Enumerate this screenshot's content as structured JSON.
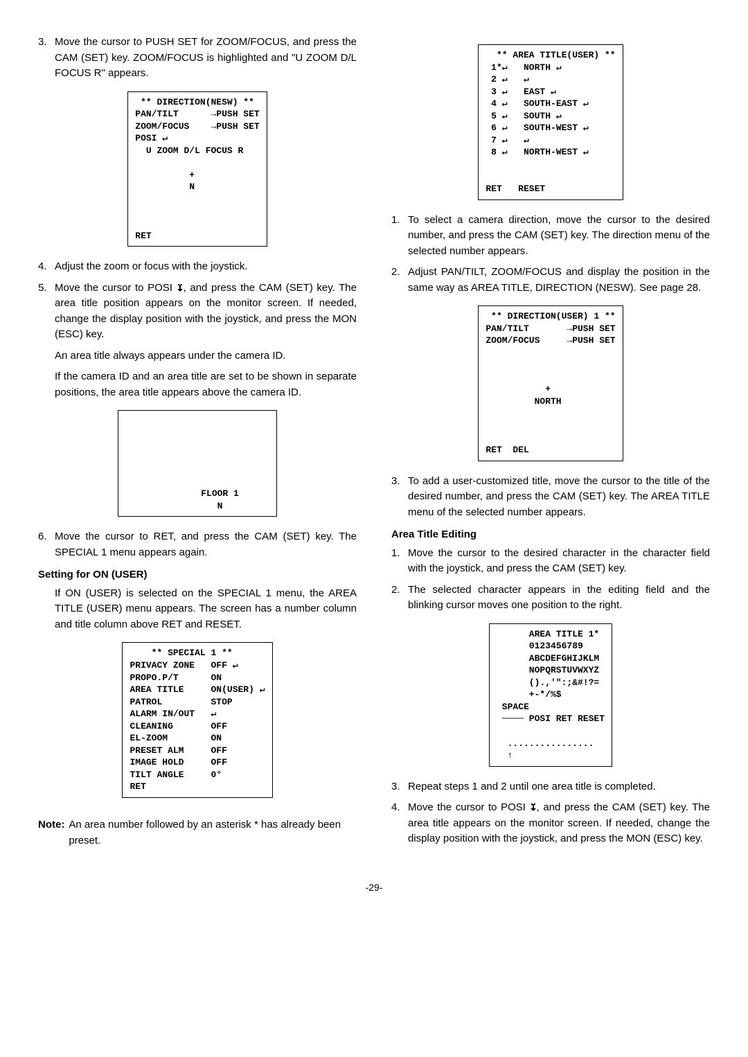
{
  "left": {
    "step3": "Move the cursor to PUSH SET for ZOOM/FOCUS, and press the CAM (SET) key. ZOOM/FOCUS is highlighted and \"U ZOOM D/L FOCUS R\" appears.",
    "menu_direction_nesw": " ** DIRECTION(NESW) **\nPAN/TILT      →PUSH SET\nZOOM/FOCUS    →PUSH SET\nPOSI ↵\n  U ZOOM D/L FOCUS R\n\n          +\n          N\n\n\n\nRET",
    "step4": "Adjust the zoom or focus with the joystick.",
    "step5a": "Move the cursor to POSI ",
    "step5b": ", and press the CAM (SET) key. The area title position appears on the monitor screen. If needed, change the display position with the joystick, and press the MON (ESC) key.",
    "step5_note1": "An area title always appears under the camera ID.",
    "step5_note2": "If the camera ID and an area title are set to be shown in separate positions, the area title appears above the camera ID.",
    "menu_floor": "\n\n\n\n\n\n              FLOOR 1\n                 N   ",
    "step6": "Move the cursor to RET, and press the CAM (SET) key. The SPECIAL 1 menu appears again.",
    "heading_onuser": "Setting for ON (USER)",
    "onuser_body": "If ON (USER) is selected on the SPECIAL 1 menu, the AREA TITLE (USER) menu appears. The screen has a number column and title column above RET and RESET.",
    "menu_special1": "    ** SPECIAL 1 **\nPRIVACY ZONE   OFF ↵\nPROPO.P/T      ON\nAREA TITLE     ON(USER) ↵\nPATROL         STOP\nALARM IN/OUT   ↵\nCLEANING       OFF\nEL-ZOOM        ON\nPRESET ALM     OFF\nIMAGE HOLD     OFF\nTILT ANGLE     0°\nRET",
    "note_label": "Note:",
    "note_body": "An area number followed by an asterisk * has already been preset."
  },
  "right": {
    "menu_area_title_user": "  ** AREA TITLE(USER) **\n 1*↵   NORTH ↵\n 2 ↵   ↵\n 3 ↵   EAST ↵\n 4 ↵   SOUTH-EAST ↵\n 5 ↵   SOUTH ↵\n 6 ↵   SOUTH-WEST ↵\n 7 ↵   ↵\n 8 ↵   NORTH-WEST ↵\n\n\nRET   RESET",
    "step1": "To select a camera direction, move the cursor to the desired number, and press the CAM (SET) key. The direction menu of the selected number appears.",
    "step2": "Adjust PAN/TILT, ZOOM/FOCUS and display the position in the same way as AREA TITLE, DIRECTION (NESW). See page 28.",
    "menu_direction_user": " ** DIRECTION(USER) 1 **\nPAN/TILT       →PUSH SET\nZOOM/FOCUS     →PUSH SET\n\n\n\n           +\n         NORTH\n\n\n\nRET  DEL",
    "step3": "To add a user-customized title, move the cursor to the title of the desired number, and press the CAM (SET) key. The AREA TITLE menu of the selected number appears.",
    "heading_edit": "Area Title Editing",
    "edit_step1": "Move the cursor to the desired character in the character field with the joystick, and press the CAM (SET) key.",
    "edit_step2": "The selected character appears in the editing field and the blinking cursor moves one position to the right.",
    "menu_area_title_edit": "      AREA TITLE 1*\n      0123456789\n      ABCDEFGHIJKLM\n      NOPQRSTUVWXYZ\n      ().,'\":;&#!?=\n      +-*/%$\n SPACE\n ──── POSI RET RESET\n\n  ................\n  ↑",
    "edit_step3": "Repeat steps 1 and 2 until one area title is completed.",
    "edit_step4a": "Move the cursor to POSI ",
    "edit_step4b": ", and press the CAM (SET) key. The area title appears on the monitor screen. If needed, change the display position with the joystick, and press the MON (ESC) key."
  },
  "nums": {
    "n1": "1.",
    "n2": "2.",
    "n3": "3.",
    "n4": "4.",
    "n5": "5.",
    "n6": "6."
  },
  "page": "-29-"
}
